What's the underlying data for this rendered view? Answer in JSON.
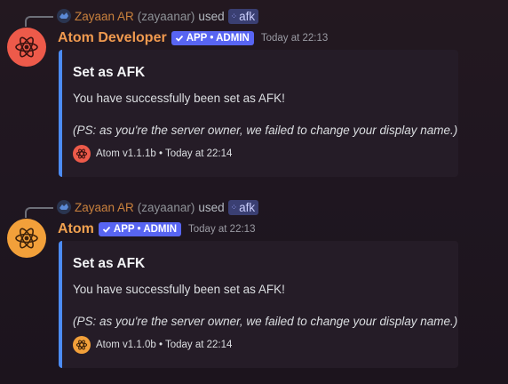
{
  "messages": [
    {
      "reply": {
        "user": "Zayaan AR",
        "handle": "(zayaanar)",
        "used": "used",
        "command": "afk"
      },
      "author": "Atom Developer",
      "badge": "APP • ADMIN",
      "timestamp": "Today at 22:13",
      "embed": {
        "title": "Set as AFK",
        "description": "You have successfully been set as AFK!",
        "note": "(PS: as you're the server owner, we failed to change your display name.)",
        "footer": "Atom v1.1.1b • Today at 22:14"
      }
    },
    {
      "reply": {
        "user": "Zayaan AR",
        "handle": "(zayaanar)",
        "used": "used",
        "command": "afk"
      },
      "author": "Atom",
      "badge": "APP • ADMIN",
      "timestamp": "Today at 22:13",
      "embed": {
        "title": "Set as AFK",
        "description": "You have successfully been set as AFK!",
        "note": "(PS: as you're the server owner, we failed to change your display name.)",
        "footer": "Atom v1.1.0b • Today at 22:14"
      }
    }
  ],
  "icons": {
    "avatar": "atom-icon",
    "reply_avatar": "user-avatar",
    "command": "slash-command-icon",
    "badge": "checkmark-icon"
  },
  "colors": {
    "embed_bar": "#4c8cf5",
    "app_badge": "#5865f2",
    "avatar_dev": "#ed5a4a",
    "avatar_prod": "#f2a03a"
  }
}
